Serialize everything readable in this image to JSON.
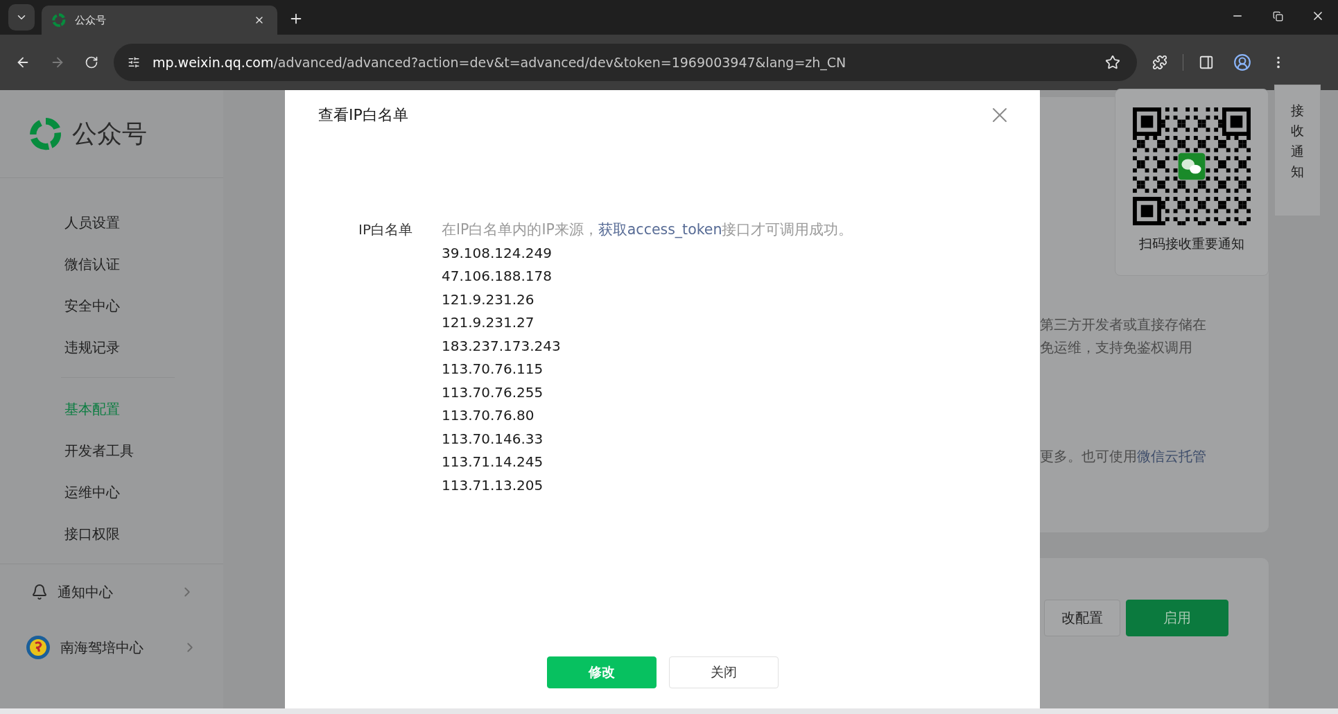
{
  "browser": {
    "tab_title": "公众号",
    "url_host": "mp.weixin.qq.com",
    "url_path": "/advanced/advanced?action=dev&t=advanced/dev&token=1969003947&lang=zh_CN"
  },
  "sidebar": {
    "brand": "公众号",
    "groups": [
      [
        {
          "label": "人员设置",
          "selected": false
        },
        {
          "label": "微信认证",
          "selected": false
        },
        {
          "label": "安全中心",
          "selected": false
        },
        {
          "label": "违规记录",
          "selected": false
        }
      ],
      [
        {
          "label": "基本配置",
          "selected": true
        },
        {
          "label": "开发者工具",
          "selected": false
        },
        {
          "label": "运维中心",
          "selected": false
        },
        {
          "label": "接口权限",
          "selected": false
        }
      ]
    ],
    "footer": [
      {
        "kind": "bell",
        "label": "通知中心"
      },
      {
        "kind": "account",
        "label": "南海驾培中心"
      }
    ]
  },
  "background": {
    "notice_tab": "接收通知",
    "qr_caption": "扫码接收重要通知",
    "lines": [
      "第三方开发者或直接存储在",
      "免运维，支持免鉴权调用"
    ],
    "link_line": {
      "text": "更多。也可使用",
      "link": "微信云托管"
    },
    "buttons": [
      {
        "label": "改配置",
        "kind": "secondary"
      },
      {
        "label": "启用",
        "kind": "primary"
      }
    ]
  },
  "dialog": {
    "title": "查看IP白名单",
    "field_label": "IP白名单",
    "hint_before": "在IP白名单内的IP来源，",
    "hint_link": "获取access_token",
    "hint_after": "接口才可调用成功。",
    "ips": [
      "39.108.124.249",
      "47.106.188.178",
      "121.9.231.26",
      "121.9.231.27",
      "183.237.173.243",
      "113.70.76.115",
      "113.70.76.255",
      "113.70.76.80",
      "113.70.146.33",
      "113.71.14.245",
      "113.71.13.205"
    ],
    "buttons": [
      {
        "label": "修改",
        "kind": "primary"
      },
      {
        "label": "关闭",
        "kind": "secondary"
      }
    ]
  }
}
